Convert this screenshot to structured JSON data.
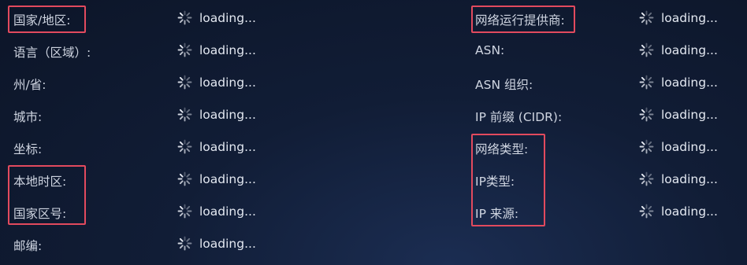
{
  "left": [
    {
      "label": "国家/地区:",
      "value": "loading..."
    },
    {
      "label": "语言（区域）:",
      "value": "loading..."
    },
    {
      "label": "州/省:",
      "value": "loading..."
    },
    {
      "label": "城市:",
      "value": "loading..."
    },
    {
      "label": "坐标:",
      "value": "loading..."
    },
    {
      "label": "本地时区:",
      "value": "loading..."
    },
    {
      "label": "国家区号:",
      "value": "loading..."
    },
    {
      "label": "邮编:",
      "value": "loading..."
    }
  ],
  "right": [
    {
      "label": "网络运行提供商:",
      "value": "loading..."
    },
    {
      "label": "ASN:",
      "value": "loading..."
    },
    {
      "label": "ASN 组织:",
      "value": "loading..."
    },
    {
      "label": "IP 前缀 (CIDR):",
      "value": "loading..."
    },
    {
      "label": "网络类型:",
      "value": "loading..."
    },
    {
      "label": "IP类型:",
      "value": "loading..."
    },
    {
      "label": "IP 来源:",
      "value": "loading..."
    }
  ],
  "icons": {
    "spinner": "loading-spinner-icon"
  },
  "colors": {
    "highlight": "#e24a5e",
    "background": "#111d36",
    "text": "#d7dce6"
  }
}
